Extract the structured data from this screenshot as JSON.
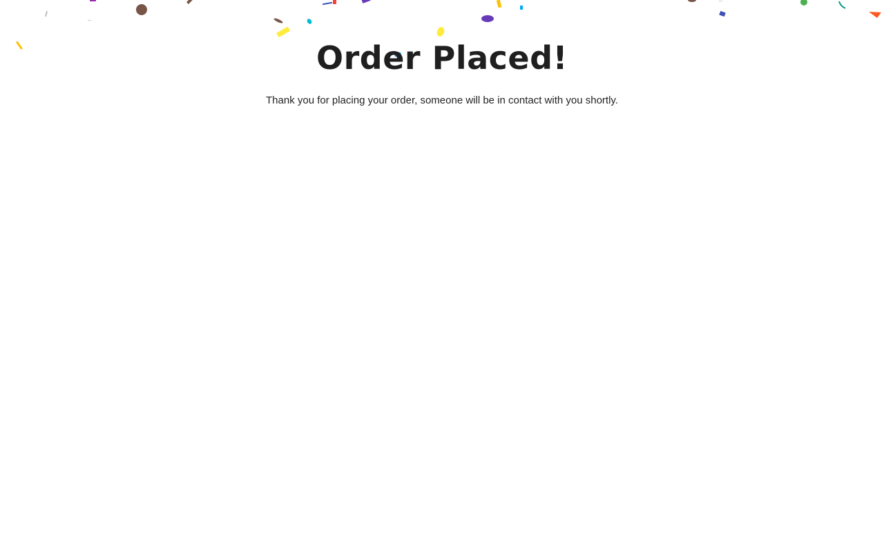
{
  "confirmation": {
    "title": "Order Placed!",
    "message": "Thank you for placing your order, someone will be in contact with you shortly."
  },
  "confetti": {
    "colors": [
      "#795548",
      "#ffeb3b",
      "#673ab7",
      "#03a9f4",
      "#00bcd4",
      "#f44336",
      "#ff5722",
      "#3f51b5",
      "#4caf50",
      "#ffc107",
      "#9c27b0",
      "#009688"
    ]
  }
}
